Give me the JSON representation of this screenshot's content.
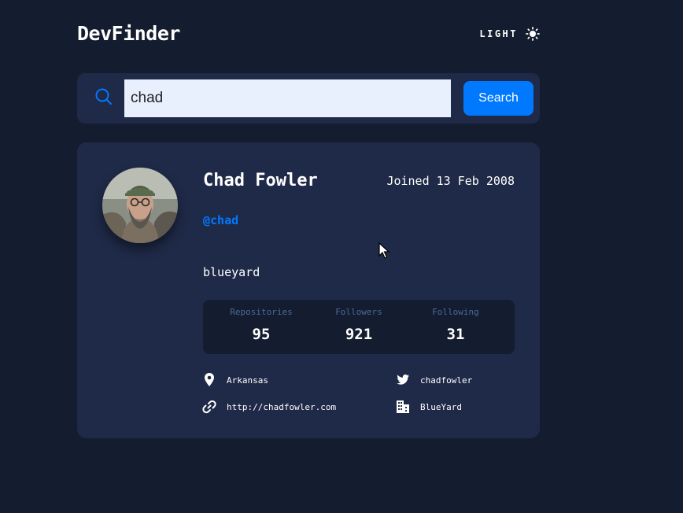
{
  "app": {
    "title": "DevFinder"
  },
  "theme_toggle": {
    "label": "LIGHT",
    "icon": "sun-icon"
  },
  "search": {
    "value": "chad",
    "placeholder": "",
    "button_label": "Search",
    "icon": "search-icon"
  },
  "profile": {
    "name": "Chad Fowler",
    "joined": "Joined 13 Feb 2008",
    "login": "@chad",
    "bio": "blueyard",
    "stats": [
      {
        "label": "Repositories",
        "value": "95"
      },
      {
        "label": "Followers",
        "value": "921"
      },
      {
        "label": "Following",
        "value": "31"
      }
    ],
    "location": "Arkansas",
    "twitter": "chadfowler",
    "blog": "http://chadfowler.com",
    "company": "BlueYard"
  },
  "colors": {
    "background": "#141c2f",
    "card": "#1f2a48",
    "accent": "#0079ff",
    "muted": "#4b6a9b"
  }
}
